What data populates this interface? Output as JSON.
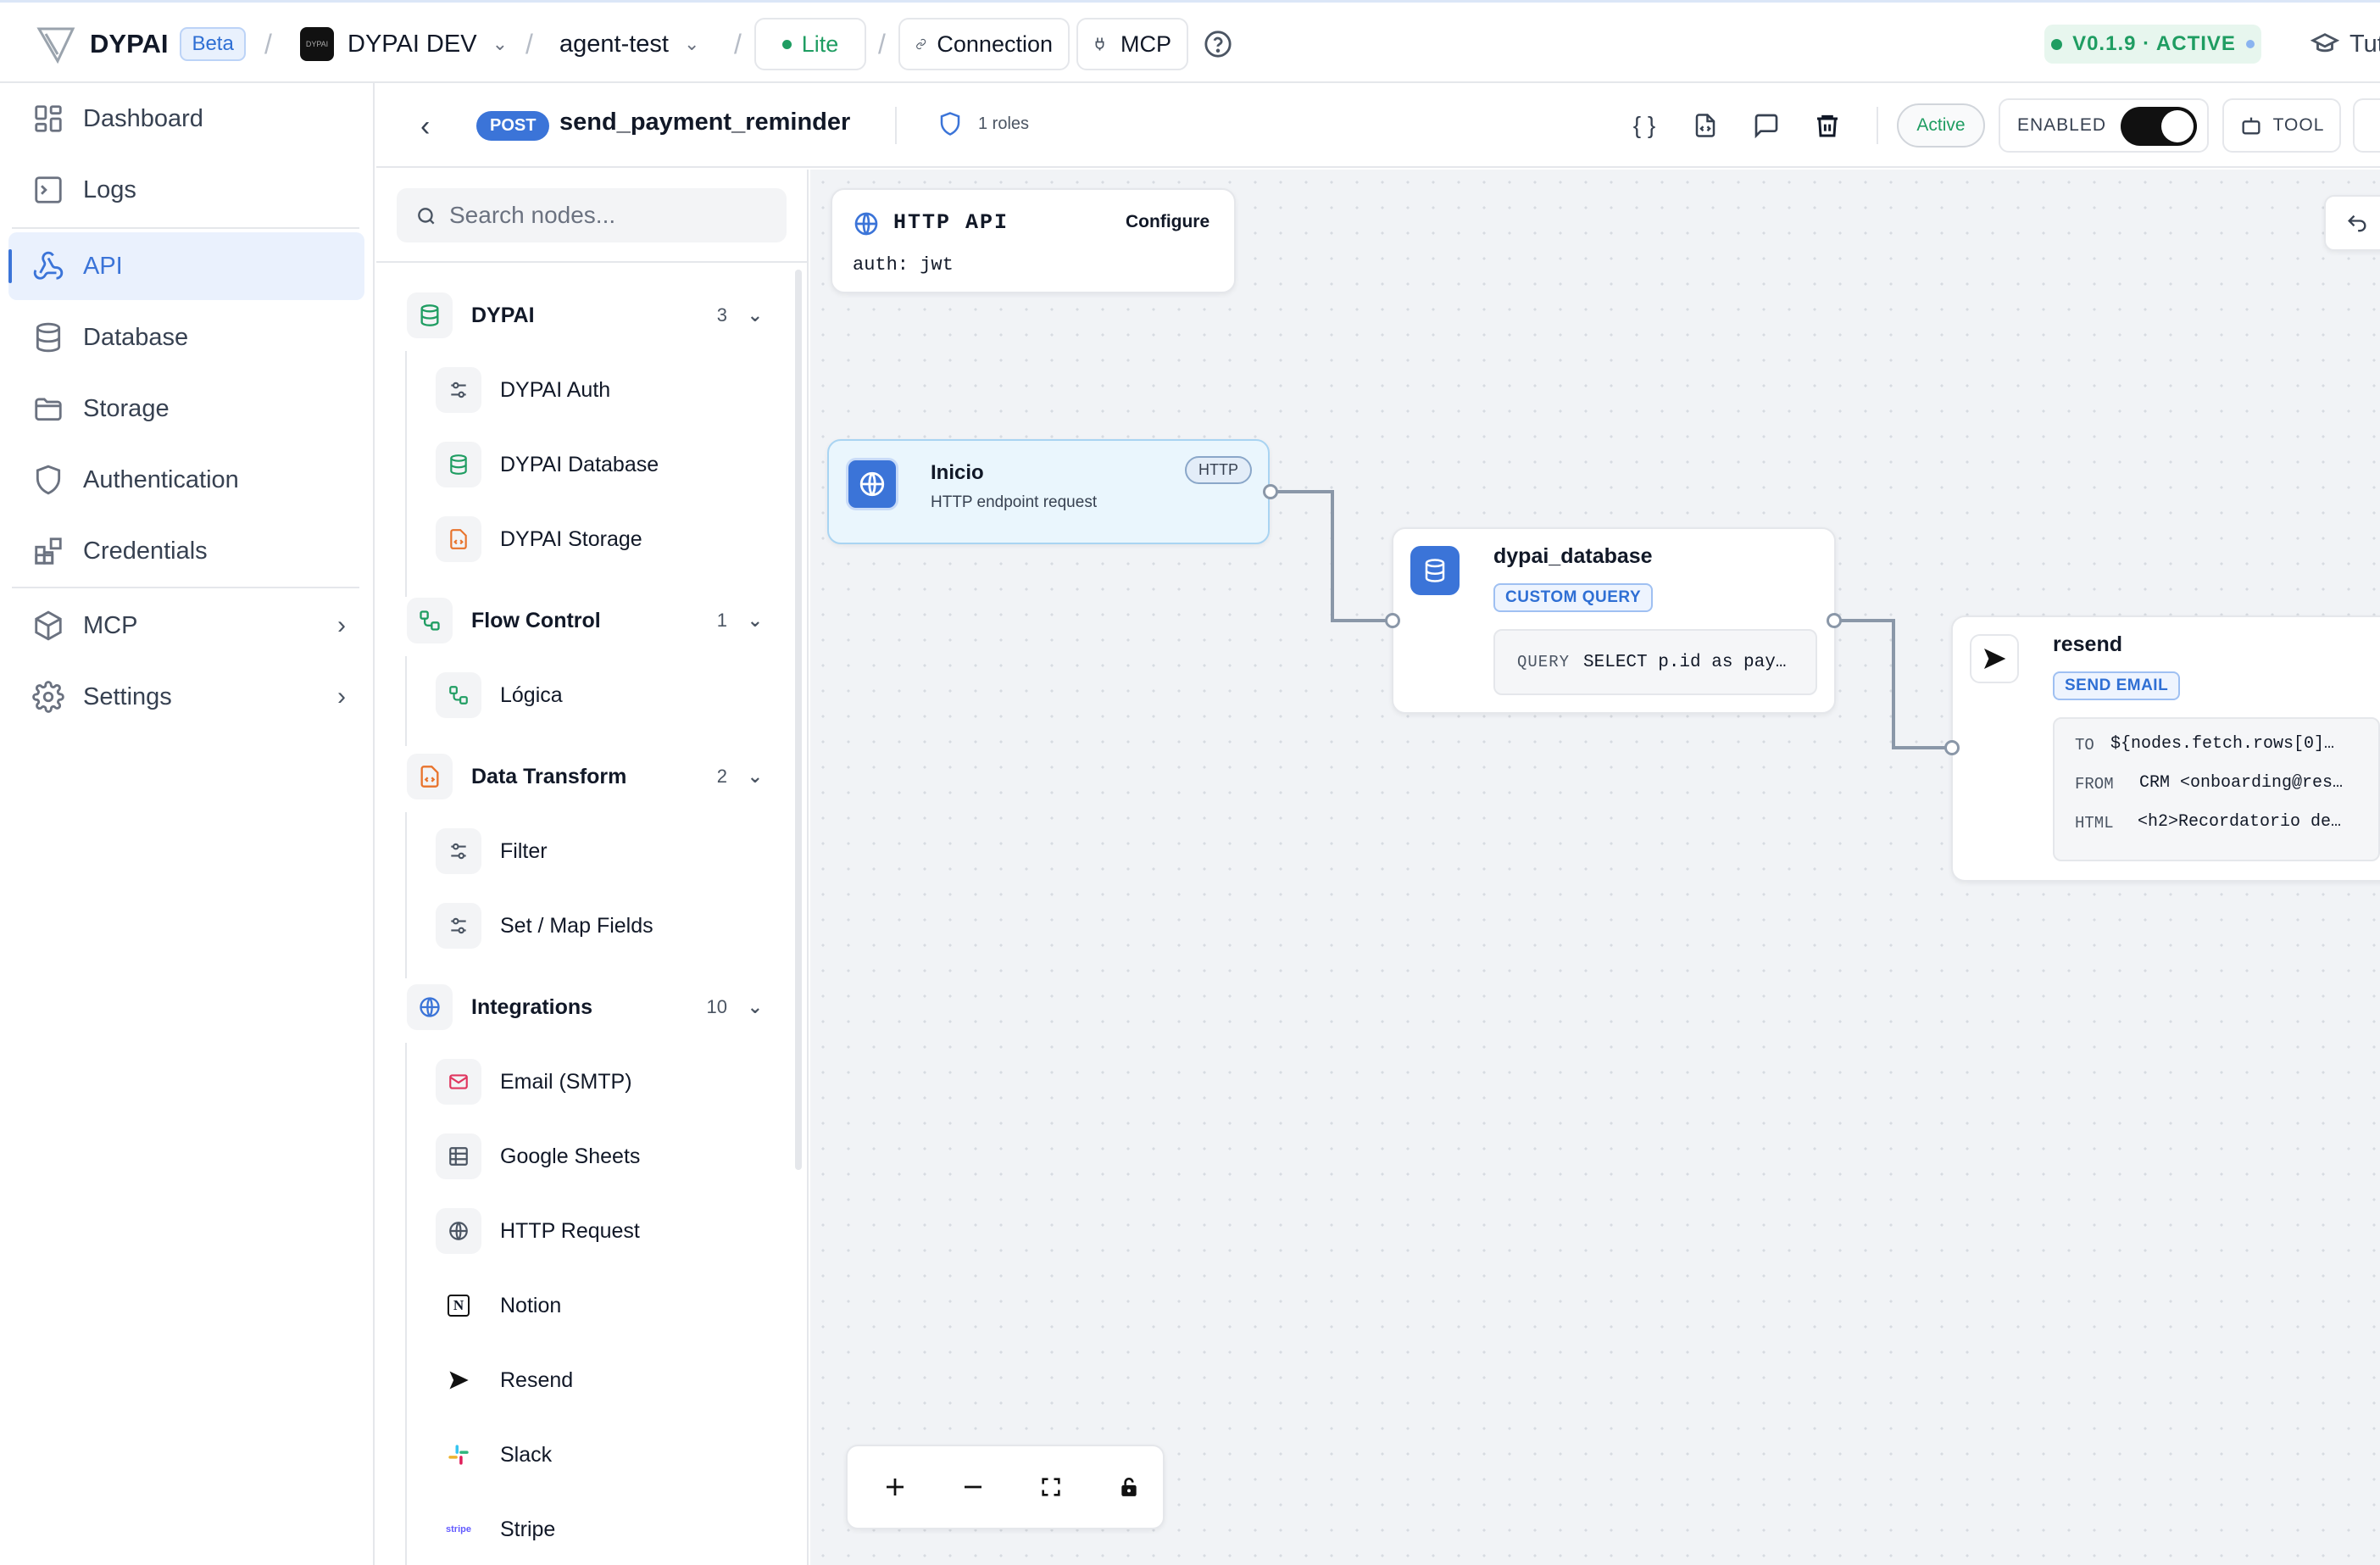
{
  "topbar": {
    "brand": "DYPAI",
    "beta": "Beta",
    "project_logo": "DYPAI",
    "project": "DYPAI DEV",
    "agent": "agent-test",
    "plan": "Lite",
    "connection": "Connection",
    "mcp": "MCP",
    "version": "V0.1.9 · ACTIVE",
    "tutorials": "Tut"
  },
  "sidebar": {
    "items": [
      {
        "label": "Dashboard",
        "icon": "dashboard-icon"
      },
      {
        "label": "Logs",
        "icon": "terminal-icon"
      },
      {
        "label": "API",
        "icon": "webhook-icon",
        "active": true
      },
      {
        "label": "Database",
        "icon": "database-icon"
      },
      {
        "label": "Storage",
        "icon": "folder-icon"
      },
      {
        "label": "Authentication",
        "icon": "shield-icon"
      },
      {
        "label": "Credentials",
        "icon": "credentials-icon"
      },
      {
        "label": "MCP",
        "icon": "cube-icon"
      },
      {
        "label": "Settings",
        "icon": "gear-icon"
      }
    ]
  },
  "endpoint": {
    "method": "POST",
    "name": "send_payment_reminder",
    "roles": "1 roles",
    "status": "Active",
    "enabled_label": "ENABLED",
    "enabled": true,
    "tool_label": "TOOL"
  },
  "panel": {
    "search_placeholder": "Search nodes...",
    "categories": [
      {
        "name": "DYPAI",
        "count": "3",
        "items": [
          "DYPAI Auth",
          "DYPAI Database",
          "DYPAI Storage"
        ]
      },
      {
        "name": "Flow Control",
        "count": "1",
        "items": [
          "Lógica"
        ]
      },
      {
        "name": "Data Transform",
        "count": "2",
        "items": [
          "Filter",
          "Set / Map Fields"
        ]
      },
      {
        "name": "Integrations",
        "count": "10",
        "items": [
          "Email (SMTP)",
          "Google Sheets",
          "HTTP Request",
          "Notion",
          "Resend",
          "Slack",
          "Stripe"
        ]
      }
    ]
  },
  "canvas": {
    "http_api": {
      "title": "HTTP API",
      "configure": "Configure",
      "auth": "auth: jwt"
    },
    "inicio": {
      "title": "Inicio",
      "subtitle": "HTTP endpoint request",
      "badge": "HTTP"
    },
    "database": {
      "title": "dypai_database",
      "tag": "CUSTOM QUERY",
      "query_label": "QUERY",
      "query_value": "SELECT p.id as pay…"
    },
    "resend": {
      "title": "resend",
      "tag": "SEND EMAIL",
      "fields": [
        {
          "label": "TO",
          "value": "${nodes.fetch.rows[0]…"
        },
        {
          "label": "FROM",
          "value": "CRM <onboarding@res…"
        },
        {
          "label": "HTML",
          "value": "<h2>Recordatorio de…"
        }
      ]
    }
  },
  "colors": {
    "accent": "#3b74d8",
    "active_green": "#1f9d62",
    "canvas_bg": "#f1f3f6"
  }
}
